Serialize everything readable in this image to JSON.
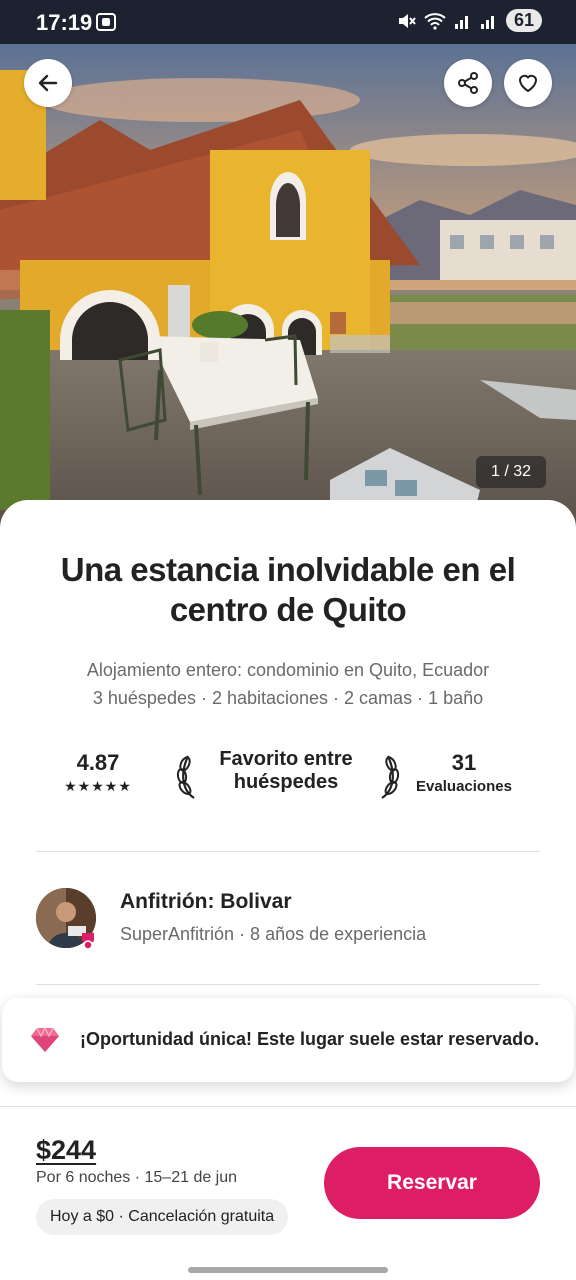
{
  "status_bar": {
    "time": "17:19",
    "battery": "61",
    "icons": [
      "screen-capture-icon",
      "mute-icon",
      "wifi-icon",
      "signal-icon",
      "battery-icon"
    ]
  },
  "gallery": {
    "counter": "1 / 32",
    "buttons": [
      "back-arrow-icon",
      "share-icon",
      "heart-icon"
    ]
  },
  "listing": {
    "title": "Una estancia inolvidable en el centro de Quito",
    "subtitle": "Alojamiento entero: condominio en Quito, Ecuador",
    "details": "3 huéspedes · 2 habitaciones · 2 camas · 1 baño"
  },
  "stats": {
    "rating": "4.87",
    "stars": "★★★★★",
    "favorite_label": "Favorito entre huéspedes",
    "reviews_count": "31",
    "reviews_label": "Evaluaciones"
  },
  "host": {
    "name": "Anfitrión: Bolivar",
    "meta": "SuperAnfitrión · 8  años de experiencia"
  },
  "promo": {
    "text": "¡Oportunidad única! Este lugar suele estar reservado."
  },
  "footer": {
    "price": "$244",
    "price_detail": "Por 6 noches · 15–21 de jun",
    "cancellation": "Hoy a $0 · Cancelación gratuita",
    "reserve_label": "Reservar"
  },
  "colors": {
    "accent": "#de1e64",
    "text": "#222222",
    "muted": "#6a6a6a"
  }
}
